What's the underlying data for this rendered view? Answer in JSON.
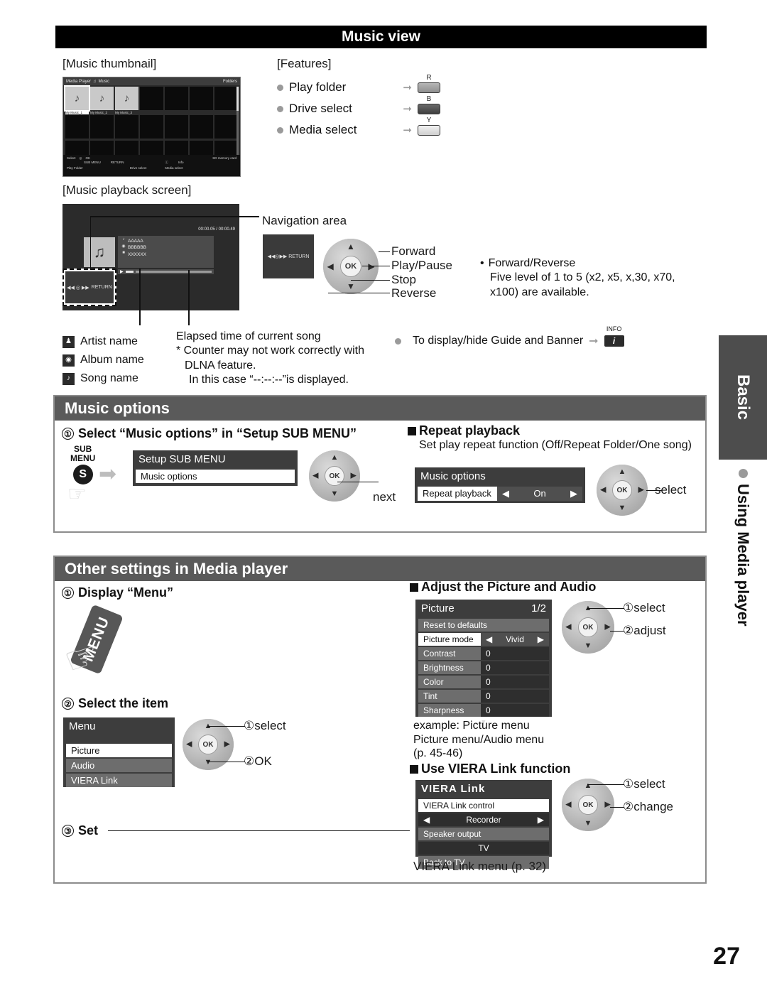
{
  "page_number": "27",
  "side_tab": {
    "label": "Basic",
    "section_bullet_label": "Using Media player"
  },
  "top_banner": {
    "title": "Music view"
  },
  "music_thumbnail": {
    "caption": "[Music thumbnail]",
    "screen": {
      "app_title": "Media Player",
      "mode": "Music",
      "music_note_icon": "music-note-icon",
      "folders_label": "Folders",
      "items": [
        "My Music_1",
        "My Music_2",
        "My Music_3"
      ],
      "footer": {
        "select": "Select",
        "ok": "OK",
        "sub_menu": "SUB MENU",
        "return": "RETURN",
        "info": "Info",
        "memory": "SD memory card",
        "play_folder": "Play Folder",
        "drive_select": "Drive select",
        "media_select": "Media select"
      }
    }
  },
  "features": {
    "caption": "[Features]",
    "items": [
      {
        "label": "Play folder",
        "button": "R",
        "color_name": "red"
      },
      {
        "label": "Drive select",
        "button": "B",
        "color_name": "blue"
      },
      {
        "label": "Media select",
        "button": "Y",
        "color_name": "yellow"
      }
    ]
  },
  "music_playback": {
    "caption": "[Music playback screen]",
    "navigation_area_label": "Navigation area",
    "screen": {
      "song_name": "AAAAA",
      "album_name": "BBBBBB",
      "artist_name": "XXXXXX",
      "time": "00:00.05 / 00:00.49",
      "return_label": "RETURN"
    },
    "dpad_labels": [
      "Forward",
      "Play/Pause",
      "Stop",
      "Reverse"
    ],
    "note": {
      "bullet": "Forward/Reverse",
      "text": "Five level of 1 to 5 (x2, x5, x,30, x70, x100) are available."
    },
    "legend": [
      {
        "icon": "person-icon",
        "label": "Artist name"
      },
      {
        "icon": "disc-icon",
        "label": "Album name"
      },
      {
        "icon": "note-icon",
        "label": "Song name"
      }
    ],
    "elapsed_note": {
      "line1": "Elapsed time of current song",
      "line2": "* Counter may not work correctly with",
      "line3": "DLNA feature.",
      "line4": "In this case “--:--:--”is displayed."
    },
    "guide_banner": {
      "label": "To display/hide Guide and Banner",
      "key_top": "INFO",
      "key_glyph": "i"
    }
  },
  "music_options": {
    "heading": "Music options",
    "step1": {
      "number": "①",
      "title": "Select “Music options” in “Setup SUB MENU”",
      "key": {
        "line1": "SUB",
        "line2": "MENU",
        "glyph": "S"
      },
      "panel": {
        "title": "Setup SUB MENU",
        "item": "Music options"
      },
      "dpad_label": "next"
    },
    "repeat": {
      "heading": "Repeat playback",
      "desc": "Set play repeat function (Off/Repeat Folder/One song)",
      "panel": {
        "title": "Music options",
        "key": "Repeat playback",
        "value": "On"
      },
      "dpad_label": "select"
    }
  },
  "other_settings": {
    "heading": "Other settings in Media player",
    "step1": {
      "number": "①",
      "title": "Display “Menu”",
      "menu_key_label": "MENU"
    },
    "step2": {
      "number": "②",
      "title": "Select the item",
      "panel": {
        "title": "Menu",
        "items": [
          "Picture",
          "Audio",
          "VIERA Link"
        ]
      },
      "dpad_labels": [
        "①select",
        "②OK"
      ]
    },
    "step3": {
      "number": "③",
      "title": "Set"
    },
    "picture_audio": {
      "heading": "Adjust the Picture and Audio",
      "panel": {
        "title": "Picture",
        "page": "1/2",
        "reset": "Reset to defaults",
        "mode_key": "Picture mode",
        "mode_value": "Vivid",
        "rows": [
          {
            "key": "Contrast",
            "value": "0"
          },
          {
            "key": "Brightness",
            "value": "0"
          },
          {
            "key": "Color",
            "value": "0"
          },
          {
            "key": "Tint",
            "value": "0"
          },
          {
            "key": "Sharpness",
            "value": "0"
          }
        ]
      },
      "dpad_labels": [
        "①select",
        "②adjust"
      ],
      "caption_l1": "example: Picture menu",
      "caption_l2": "Picture menu/Audio menu",
      "caption_l3": "(p. 45-46)"
    },
    "viera_link": {
      "heading": "Use VIERA Link function",
      "panel": {
        "logo": "VIERA Link",
        "control_key": "VIERA Link control",
        "control_value": "Recorder",
        "speaker_key": "Speaker output",
        "speaker_value": "TV",
        "back": "Back to TV"
      },
      "dpad_labels": [
        "①select",
        "②change"
      ],
      "caption": "VIERA Link menu (p. 32)"
    }
  }
}
